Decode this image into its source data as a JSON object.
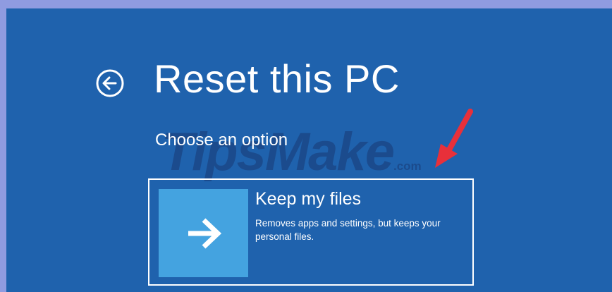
{
  "page": {
    "title": "Reset this PC",
    "subtitle": "Choose an option",
    "back_icon": "back-arrow-circle-icon"
  },
  "options": [
    {
      "title": "Keep my files",
      "description": "Removes apps and settings, but keeps your personal files.",
      "icon": "arrow-right-icon"
    }
  ],
  "watermark": {
    "text": "TipsMake",
    "suffix": ".com"
  },
  "colors": {
    "background": "#1f62ad",
    "tile": "#44a3e0",
    "frame": "#8f9be0",
    "annotation": "#e8303a"
  }
}
